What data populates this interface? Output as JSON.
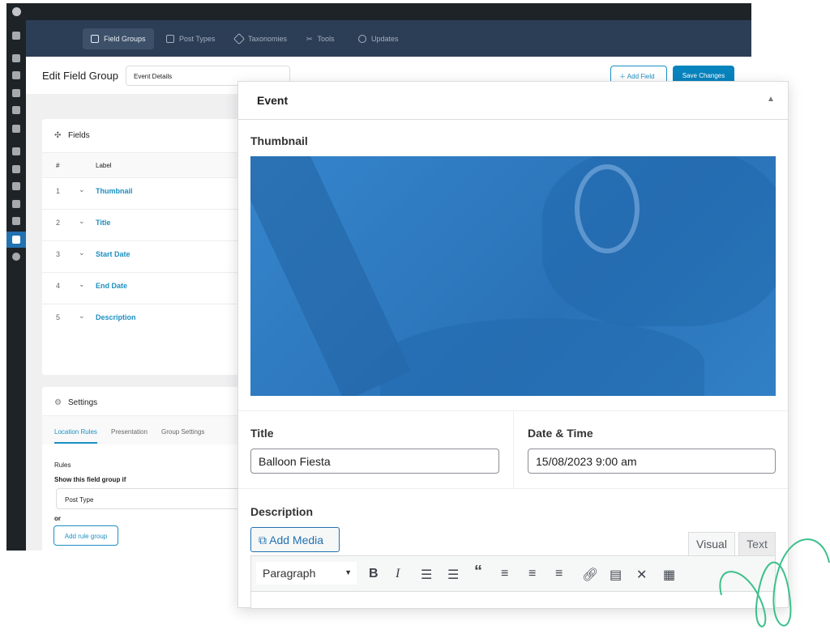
{
  "nav": {
    "items": [
      {
        "label": "Field Groups",
        "icon": "list-icon",
        "active": true
      },
      {
        "label": "Post Types",
        "icon": "document-icon"
      },
      {
        "label": "Taxonomies",
        "icon": "tag-icon"
      },
      {
        "label": "Tools",
        "icon": "tools-icon"
      },
      {
        "label": "Updates",
        "icon": "download-icon"
      }
    ]
  },
  "header": {
    "title": "Edit Field Group",
    "group_name": "Event Details",
    "add_field": "Add Field",
    "save": "Save Changes"
  },
  "fields": {
    "title": "Fields",
    "col_num": "#",
    "col_label": "Label",
    "rows": [
      {
        "n": "1",
        "label": "Thumbnail"
      },
      {
        "n": "2",
        "label": "Title"
      },
      {
        "n": "3",
        "label": "Start Date"
      },
      {
        "n": "4",
        "label": "End Date"
      },
      {
        "n": "5",
        "label": "Description"
      }
    ]
  },
  "settings": {
    "title": "Settings",
    "tabs": [
      "Location Rules",
      "Presentation",
      "Group Settings"
    ],
    "rules": "Rules",
    "show_if": "Show this field group if",
    "select_value": "Post Type",
    "or": "or",
    "add_rule_group": "Add rule group"
  },
  "event": {
    "title": "Event",
    "thumbnail_label": "Thumbnail",
    "title_label": "Title",
    "title_value": "Balloon Fiesta",
    "date_label": "Date & Time",
    "date_value": "15/08/2023 9:00 am",
    "description_label": "Description",
    "add_media": "Add Media",
    "tab_visual": "Visual",
    "tab_text": "Text",
    "format_value": "Paragraph"
  },
  "colors": {
    "accent": "#2271b1",
    "link": "#1d8fc2",
    "nav": "#2c3e55",
    "image": "#2f7cc4",
    "squiggle": "#3cc08a"
  }
}
